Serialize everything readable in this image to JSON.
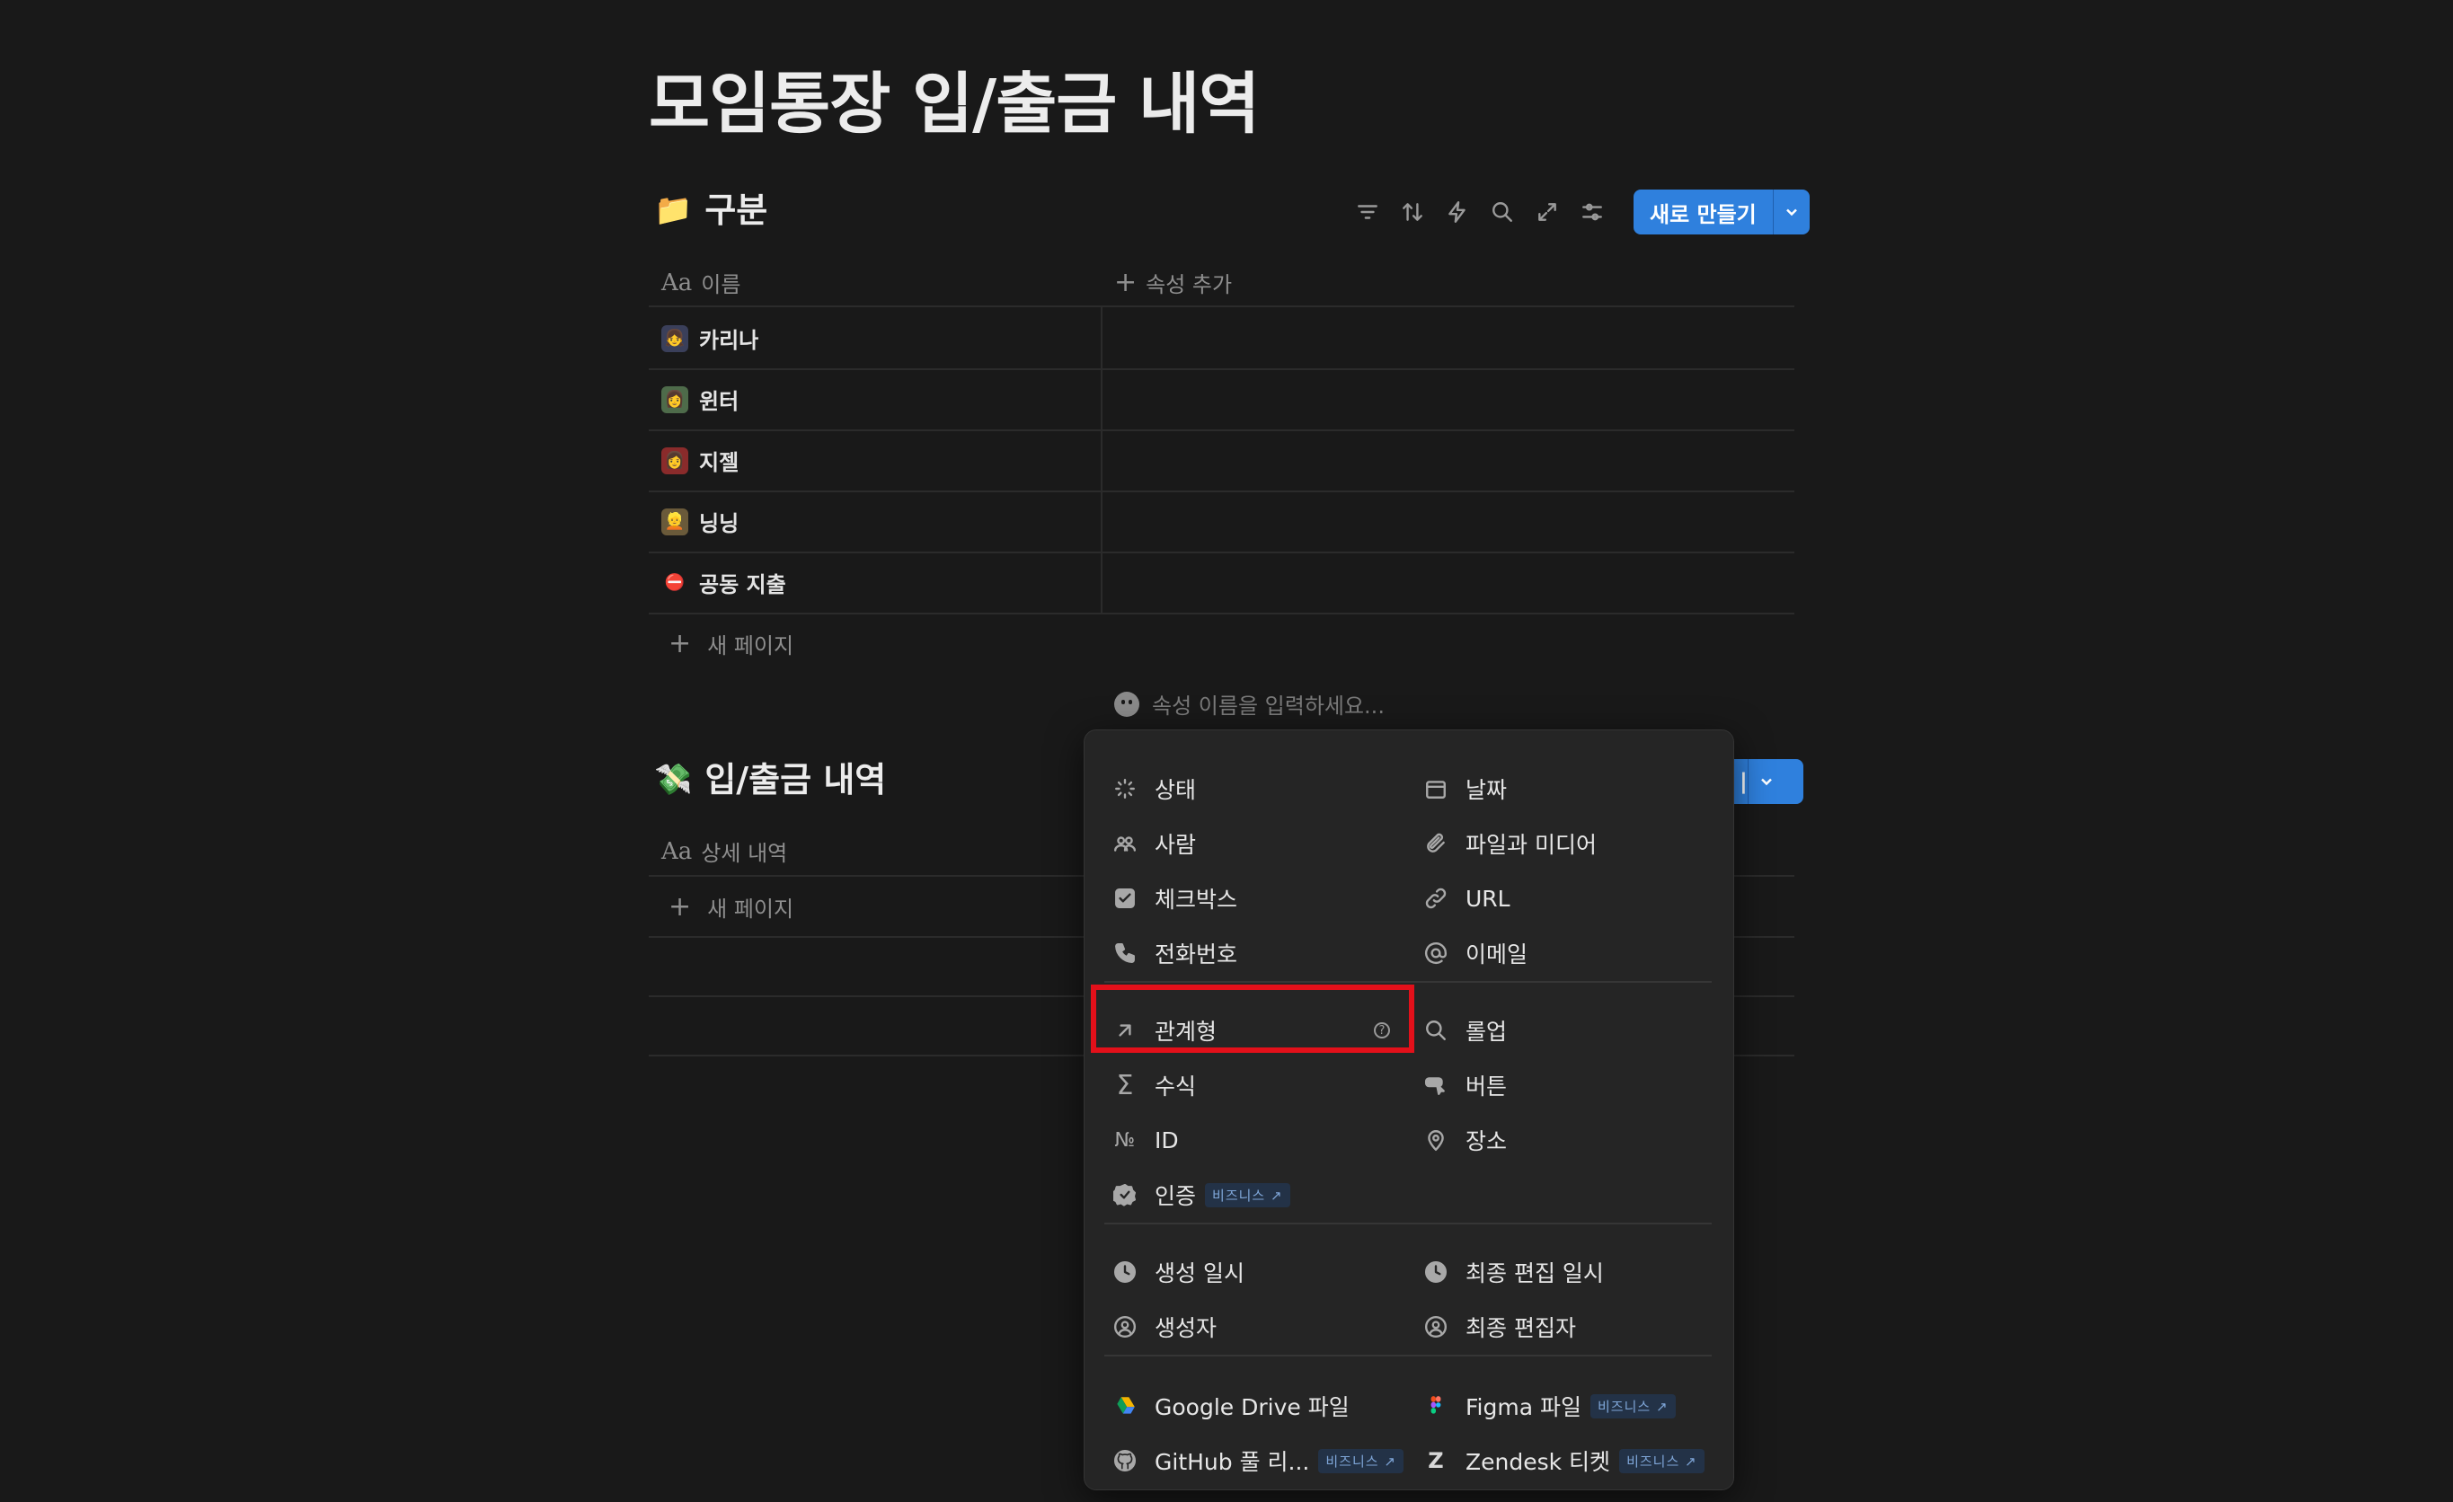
{
  "page": {
    "title": "모임통장 입/출금 내역"
  },
  "db1": {
    "icon": "folder-icon",
    "title": "구분",
    "new_button": "새로 만들기",
    "col_name": "이름",
    "col_add": "속성 추가",
    "rows": [
      "카리나",
      "윈터",
      "지젤",
      "닝닝",
      "공동 지출"
    ],
    "new_page": "새 페이지"
  },
  "db2": {
    "icon": "money-icon",
    "title": "입/출금 내역",
    "col_name": "상세 내역",
    "new_page": "새 페이지"
  },
  "prop_input": {
    "placeholder": "속성 이름을 입력하세요..."
  },
  "menu": {
    "status": "상태",
    "date": "날짜",
    "person": "사람",
    "files": "파일과 미디어",
    "checkbox": "체크박스",
    "url": "URL",
    "phone": "전화번호",
    "email": "이메일",
    "relation": "관계형",
    "rollup": "롤업",
    "formula": "수식",
    "button": "버튼",
    "id": "ID",
    "place": "장소",
    "verify": "인증",
    "created_time": "생성 일시",
    "edited_time": "최종 편집 일시",
    "created_by": "생성자",
    "edited_by": "최종 편집자",
    "gdrive": "Google Drive 파일",
    "figma": "Figma 파일",
    "github": "GitHub 풀 리...",
    "zendesk": "Zendesk 티켓",
    "business": "비즈니스 ↗"
  }
}
